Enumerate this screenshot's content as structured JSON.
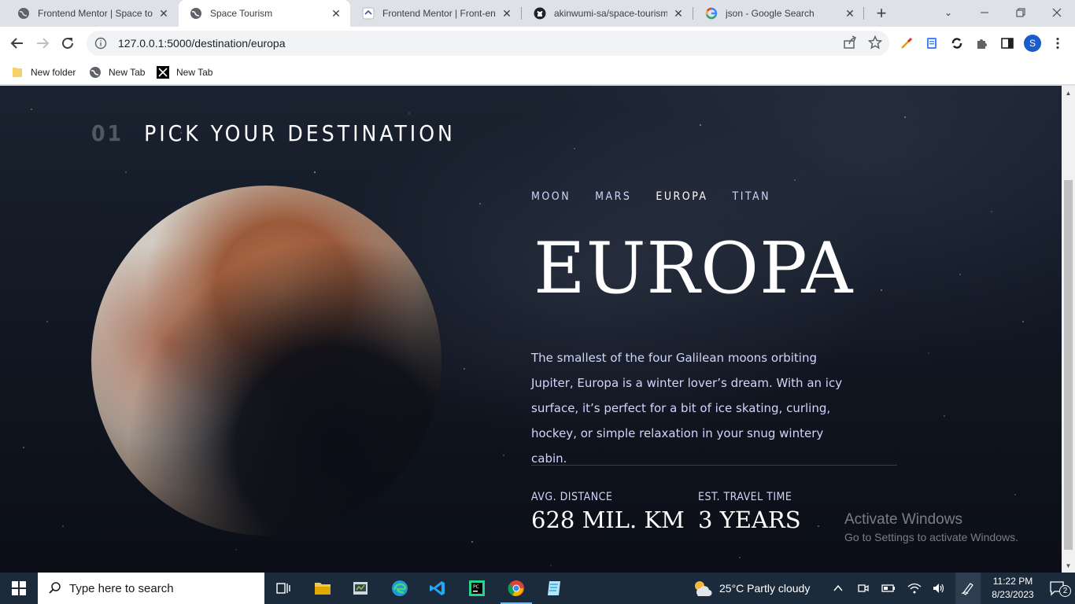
{
  "browser": {
    "tabs": [
      {
        "title": "Frontend Mentor | Space tou",
        "icon": "globe-icon",
        "active": false
      },
      {
        "title": "Space Tourism",
        "icon": "globe-icon",
        "active": true
      },
      {
        "title": "Frontend Mentor | Front-end",
        "icon": "frontend-mentor-icon",
        "active": false
      },
      {
        "title": "akinwumi-sa/space-tourism-",
        "icon": "github-icon",
        "active": false
      },
      {
        "title": "json - Google Search",
        "icon": "google-icon",
        "active": false
      }
    ],
    "address": "127.0.0.1:5000/destination/europa",
    "bookmarks": [
      {
        "label": "New folder",
        "icon": "folder-icon"
      },
      {
        "label": "New Tab",
        "icon": "globe-icon"
      },
      {
        "label": "New Tab",
        "icon": "x-logo-icon"
      }
    ],
    "profile_initial": "S"
  },
  "page": {
    "heading_number": "01",
    "heading_title": "PICK YOUR DESTINATION",
    "destinations": [
      "MOON",
      "MARS",
      "EUROPA",
      "TITAN"
    ],
    "active_destination": "EUROPA",
    "name": "EUROPA",
    "description": "The smallest of the four Galilean moons orbiting Jupiter, Europa is a winter lover’s dream. With an icy surface, it’s perfect for a bit of ice skating, curling, hockey, or simple relaxation in your snug wintery cabin.",
    "stats": [
      {
        "label": "AVG. DISTANCE",
        "value": "628 MIL. KM"
      },
      {
        "label": "EST. TRAVEL TIME",
        "value": "3 YEARS"
      }
    ],
    "colors": {
      "accent": "#d0d6f9",
      "background": "#0b0e16",
      "white": "#ffffff"
    }
  },
  "watermark": {
    "line1": "Activate Windows",
    "line2": "Go to Settings to activate Windows."
  },
  "taskbar": {
    "search_placeholder": "Type here to search",
    "weather": "25°C  Partly cloudy",
    "time": "11:22 PM",
    "date": "8/23/2023",
    "notification_count": "2"
  }
}
